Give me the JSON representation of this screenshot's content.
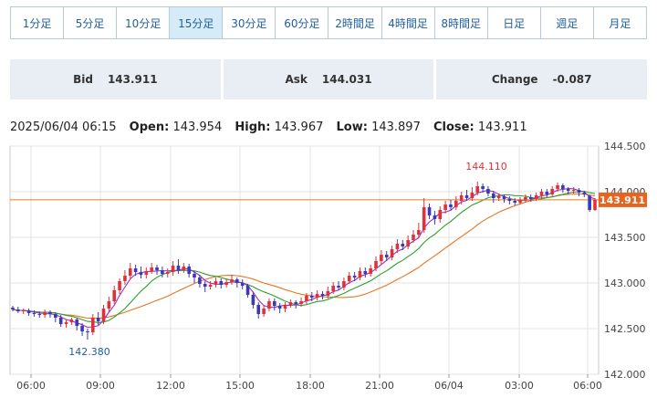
{
  "tabs": [
    "1分足",
    "5分足",
    "10分足",
    "15分足",
    "30分足",
    "60分足",
    "2時間足",
    "4時間足",
    "8時間足",
    "日足",
    "週足",
    "月足"
  ],
  "active_tab": 3,
  "quote": {
    "bid_label": "Bid",
    "bid_value": "143.911",
    "ask_label": "Ask",
    "ask_value": "144.031",
    "change_label": "Change",
    "change_value": "-0.087"
  },
  "ohlc": {
    "datetime": "2025/06/04 06:15",
    "open_label": "Open:",
    "open_value": "143.954",
    "high_label": "High:",
    "high_value": "143.967",
    "low_label": "Low:",
    "low_value": "143.897",
    "close_label": "Close:",
    "close_value": "143.911"
  },
  "colors": {
    "up": "#e0313b",
    "down": "#3a3ab8",
    "ma_short": "#9b2fc0",
    "ma_mid": "#2ca02c",
    "ma_long": "#e8761e",
    "price_line": "#e07b2a",
    "price_tag": "#e8641e",
    "accent": "#1f5f9a"
  },
  "chart_data": {
    "type": "candlestick",
    "x_ticks": [
      "06:00",
      "09:00",
      "12:00",
      "15:00",
      "18:00",
      "21:00",
      "06/04",
      "03:00",
      "06:00"
    ],
    "y_ticks": [
      "144.500",
      "144.000",
      "143.500",
      "143.000",
      "142.500",
      "142.000"
    ],
    "ylim": [
      142.0,
      144.5
    ],
    "current_price": 143.911,
    "current_price_label": "143.911",
    "annotation_high": {
      "label": "144.110",
      "value": 144.11
    },
    "annotation_low": {
      "label": "142.380",
      "value": 142.38
    },
    "candles": [
      [
        142.73,
        142.71,
        142.75,
        142.69
      ],
      [
        142.71,
        142.69,
        142.74,
        142.67
      ],
      [
        142.69,
        142.7,
        142.72,
        142.66
      ],
      [
        142.7,
        142.67,
        142.72,
        142.64
      ],
      [
        142.67,
        142.66,
        142.7,
        142.63
      ],
      [
        142.66,
        142.65,
        142.69,
        142.62
      ],
      [
        142.65,
        142.68,
        142.71,
        142.62
      ],
      [
        142.68,
        142.66,
        142.7,
        142.62
      ],
      [
        142.66,
        142.62,
        142.68,
        142.57
      ],
      [
        142.62,
        142.55,
        142.65,
        142.52
      ],
      [
        142.55,
        142.57,
        142.6,
        142.51
      ],
      [
        142.57,
        142.6,
        142.62,
        142.54
      ],
      [
        142.6,
        142.53,
        142.62,
        142.48
      ],
      [
        142.53,
        142.47,
        142.56,
        142.42
      ],
      [
        142.47,
        142.46,
        142.5,
        142.38
      ],
      [
        142.46,
        142.62,
        142.66,
        142.43
      ],
      [
        142.62,
        142.58,
        142.68,
        142.54
      ],
      [
        142.58,
        142.72,
        142.76,
        142.55
      ],
      [
        142.72,
        142.8,
        142.85,
        142.68
      ],
      [
        142.8,
        142.92,
        142.97,
        142.77
      ],
      [
        142.92,
        143.02,
        143.05,
        142.88
      ],
      [
        143.02,
        143.08,
        143.14,
        142.98
      ],
      [
        143.08,
        143.16,
        143.22,
        143.04
      ],
      [
        143.16,
        143.12,
        143.2,
        143.08
      ],
      [
        143.12,
        143.09,
        143.18,
        143.05
      ],
      [
        143.09,
        143.13,
        143.17,
        143.05
      ],
      [
        143.13,
        143.17,
        143.22,
        143.1
      ],
      [
        143.17,
        143.14,
        143.2,
        143.09
      ],
      [
        143.14,
        143.1,
        143.18,
        143.06
      ],
      [
        143.1,
        143.12,
        143.16,
        143.06
      ],
      [
        143.12,
        143.19,
        143.24,
        143.08
      ],
      [
        143.19,
        143.14,
        143.26,
        143.1
      ],
      [
        143.14,
        143.18,
        143.22,
        143.11
      ],
      [
        143.18,
        143.1,
        143.21,
        143.06
      ],
      [
        143.1,
        143.06,
        143.13,
        143.0
      ],
      [
        143.06,
        142.99,
        143.09,
        142.95
      ],
      [
        142.99,
        142.96,
        143.02,
        142.9
      ],
      [
        142.96,
        142.98,
        143.02,
        142.93
      ],
      [
        142.98,
        143.02,
        143.06,
        142.95
      ],
      [
        143.02,
        142.98,
        143.05,
        142.94
      ],
      [
        142.98,
        143.01,
        143.05,
        142.95
      ],
      [
        143.01,
        143.04,
        143.09,
        142.98
      ],
      [
        143.04,
        143.0,
        143.06,
        142.95
      ],
      [
        143.0,
        142.97,
        143.04,
        142.93
      ],
      [
        142.97,
        142.87,
        142.99,
        142.84
      ],
      [
        142.87,
        142.76,
        142.9,
        142.72
      ],
      [
        142.76,
        142.66,
        142.79,
        142.61
      ],
      [
        142.66,
        142.72,
        142.76,
        142.63
      ],
      [
        142.72,
        142.8,
        142.83,
        142.69
      ],
      [
        142.8,
        142.75,
        142.83,
        142.7
      ],
      [
        142.75,
        142.72,
        142.78,
        142.67
      ],
      [
        142.72,
        142.76,
        142.79,
        142.68
      ],
      [
        142.76,
        142.79,
        142.82,
        142.73
      ],
      [
        142.79,
        142.77,
        142.81,
        142.72
      ],
      [
        142.77,
        142.8,
        142.84,
        142.74
      ],
      [
        142.8,
        142.86,
        142.89,
        142.77
      ],
      [
        142.86,
        142.84,
        142.9,
        142.8
      ],
      [
        142.84,
        142.88,
        142.92,
        142.81
      ],
      [
        142.88,
        142.86,
        142.91,
        142.82
      ],
      [
        142.86,
        142.91,
        142.96,
        142.83
      ],
      [
        142.91,
        142.97,
        143.01,
        142.88
      ],
      [
        142.97,
        142.95,
        143.02,
        142.92
      ],
      [
        142.95,
        143.02,
        143.06,
        142.92
      ],
      [
        143.02,
        143.08,
        143.12,
        142.99
      ],
      [
        143.08,
        143.06,
        143.12,
        143.02
      ],
      [
        143.06,
        143.13,
        143.17,
        143.03
      ],
      [
        143.13,
        143.1,
        143.17,
        143.06
      ],
      [
        143.1,
        143.16,
        143.2,
        143.07
      ],
      [
        143.16,
        143.24,
        143.29,
        143.13
      ],
      [
        143.24,
        143.31,
        143.36,
        143.2
      ],
      [
        143.31,
        143.28,
        143.35,
        143.24
      ],
      [
        143.28,
        143.37,
        143.41,
        143.25
      ],
      [
        143.37,
        143.43,
        143.48,
        143.33
      ],
      [
        143.43,
        143.4,
        143.47,
        143.36
      ],
      [
        143.4,
        143.47,
        143.52,
        143.37
      ],
      [
        143.47,
        143.53,
        143.58,
        143.44
      ],
      [
        143.53,
        143.58,
        143.66,
        143.5
      ],
      [
        143.58,
        143.83,
        143.93,
        143.55
      ],
      [
        143.83,
        143.74,
        143.87,
        143.7
      ],
      [
        143.74,
        143.7,
        143.79,
        143.64
      ],
      [
        143.7,
        143.8,
        143.84,
        143.66
      ],
      [
        143.8,
        143.86,
        143.9,
        143.76
      ],
      [
        143.86,
        143.83,
        143.91,
        143.79
      ],
      [
        143.83,
        143.9,
        143.95,
        143.8
      ],
      [
        143.9,
        143.96,
        144.0,
        143.86
      ],
      [
        143.96,
        143.93,
        144.02,
        143.9
      ],
      [
        143.93,
        143.99,
        144.05,
        143.9
      ],
      [
        143.99,
        144.06,
        144.11,
        143.96
      ],
      [
        144.06,
        144.03,
        144.09,
        143.99
      ],
      [
        144.03,
        143.98,
        144.06,
        143.95
      ],
      [
        143.98,
        143.93,
        144.01,
        143.88
      ],
      [
        143.93,
        143.95,
        143.98,
        143.9
      ],
      [
        143.95,
        143.92,
        143.97,
        143.88
      ],
      [
        143.92,
        143.9,
        143.95,
        143.86
      ],
      [
        143.9,
        143.88,
        143.93,
        143.85
      ],
      [
        143.88,
        143.91,
        143.94,
        143.86
      ],
      [
        143.91,
        143.94,
        143.97,
        143.88
      ],
      [
        143.94,
        143.92,
        143.97,
        143.89
      ],
      [
        143.92,
        143.96,
        143.99,
        143.9
      ],
      [
        143.96,
        144.0,
        144.03,
        143.93
      ],
      [
        144.0,
        143.97,
        144.03,
        143.94
      ],
      [
        143.97,
        144.03,
        144.06,
        143.95
      ],
      [
        144.03,
        144.07,
        144.1,
        144.0
      ],
      [
        144.07,
        144.03,
        144.09,
        143.99
      ],
      [
        144.03,
        144.01,
        144.05,
        143.97
      ],
      [
        144.01,
        144.02,
        144.05,
        143.98
      ],
      [
        144.02,
        143.99,
        144.04,
        143.95
      ],
      [
        143.99,
        143.97,
        144.01,
        143.94
      ],
      [
        143.954,
        143.8,
        143.967,
        143.78
      ],
      [
        143.8,
        143.911,
        143.93,
        143.79
      ]
    ]
  }
}
